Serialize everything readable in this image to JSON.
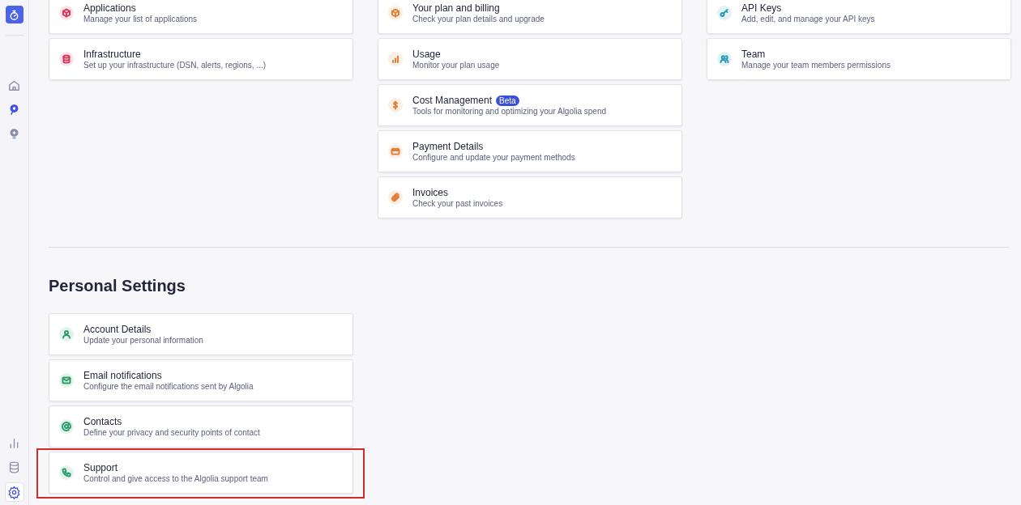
{
  "sidebar": {
    "top": [
      {
        "kind": "home",
        "selected": false
      },
      {
        "kind": "search",
        "selected": true
      },
      {
        "kind": "idea",
        "selected": false
      }
    ],
    "bottom": [
      {
        "kind": "chart",
        "selected": false
      },
      {
        "kind": "database",
        "selected": false
      },
      {
        "kind": "settings",
        "selected": true
      }
    ]
  },
  "columns": [
    [
      {
        "kind": "cube",
        "color": "#d6365a",
        "title": "Applications",
        "description": "Manage your list of applications",
        "highlighted": false
      },
      {
        "kind": "database",
        "color": "#d6365a",
        "title": "Infrastructure",
        "description": "Set up your infrastructure (DSN, alerts, regions, ...)",
        "highlighted": false
      }
    ],
    [
      {
        "kind": "cube",
        "color": "#e0813a",
        "title": "Your plan and billing",
        "description": "Check your plan details and upgrade",
        "highlighted": false
      },
      {
        "kind": "bars",
        "color": "#e0813a",
        "title": "Usage",
        "description": "Monitor your plan usage",
        "highlighted": false
      },
      {
        "kind": "dollar",
        "color": "#e0813a",
        "title": "Cost Management",
        "badge": "Beta",
        "description": "Tools for monitoring and optimizing your Algolia spend",
        "highlighted": false
      },
      {
        "kind": "card",
        "color": "#e0813a",
        "title": "Payment Details",
        "description": "Configure and update your payment methods",
        "highlighted": false
      },
      {
        "kind": "clip",
        "color": "#e0813a",
        "title": "Invoices",
        "description": "Check your past invoices",
        "highlighted": false
      }
    ],
    [
      {
        "kind": "key",
        "color": "#2a9bb5",
        "title": "API Keys",
        "description": "Add, edit, and manage your API keys",
        "highlighted": false
      },
      {
        "kind": "users",
        "color": "#2a9bb5",
        "title": "Team",
        "description": "Manage your team members permissions",
        "highlighted": false
      }
    ]
  ],
  "personal": {
    "heading": "Personal Settings",
    "items": [
      {
        "kind": "user",
        "color": "#2a9d6b",
        "title": "Account Details",
        "description": "Update your personal information",
        "highlighted": false
      },
      {
        "kind": "mail",
        "color": "#2a9d6b",
        "title": "Email notifications",
        "description": "Configure the email notifications sent by Algolia",
        "highlighted": false
      },
      {
        "kind": "at",
        "color": "#2a9d6b",
        "title": "Contacts",
        "description": "Define your privacy and security points of contact",
        "highlighted": false
      },
      {
        "kind": "phone",
        "color": "#2a9d6b",
        "title": "Support",
        "description": "Control and give access to the Algolia support team",
        "highlighted": true
      }
    ]
  }
}
